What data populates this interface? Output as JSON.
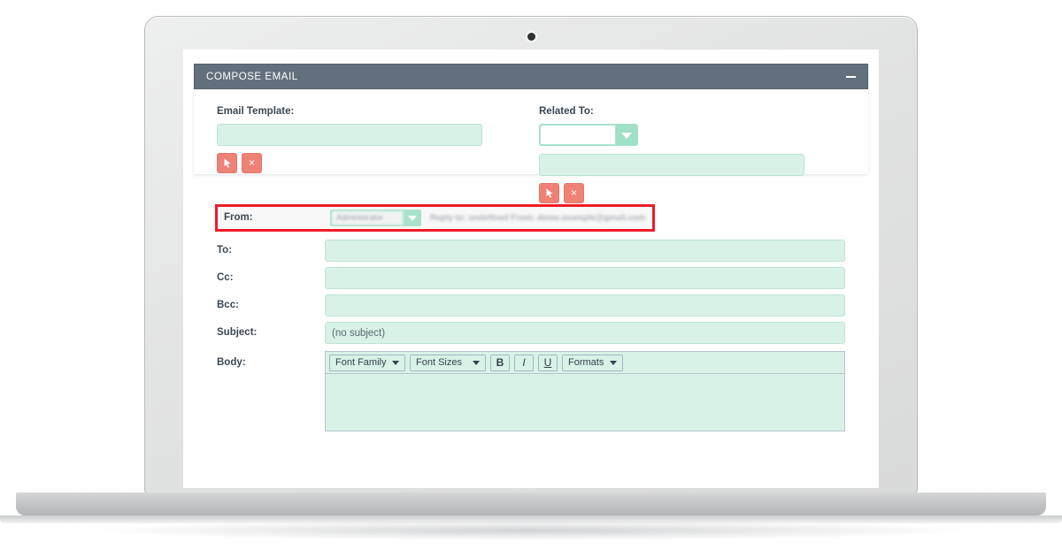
{
  "device": {
    "type": "laptop-mockup",
    "webcam": "webcam-dot"
  },
  "panel": {
    "title": "COMPOSE EMAIL",
    "minimize_label": "–",
    "header_color": "#61707c"
  },
  "colors": {
    "header": "#61707c",
    "input_fill": "#d8f2e7",
    "input_border": "#bce3d2",
    "accent_button": "#ee8276",
    "highlight": "#ee1c25",
    "dropdown_arrow_bg": "#9fe0c6"
  },
  "form": {
    "email_template": {
      "label": "Email Template:",
      "value": "",
      "placeholder": "",
      "buttons": [
        {
          "name": "select",
          "glyph": "⬈"
        },
        {
          "name": "clear",
          "glyph": "×"
        }
      ]
    },
    "related_to": {
      "label": "Related To:",
      "select_value": "",
      "text_value": "",
      "buttons": [
        {
          "name": "select",
          "glyph": "⬈"
        },
        {
          "name": "clear",
          "glyph": "×"
        }
      ]
    },
    "from": {
      "label": "From:",
      "select_value": "Administrator",
      "note": "Reply to: undefined From: demo.example@gmail.com",
      "highlighted": true
    },
    "rows": [
      {
        "label": "To:",
        "value": ""
      },
      {
        "label": "Cc:",
        "value": ""
      },
      {
        "label": "Bcc:",
        "value": ""
      },
      {
        "label": "Subject:",
        "value": "(no subject)"
      }
    ],
    "body": {
      "label": "Body:",
      "content": "",
      "toolbar": [
        {
          "name": "font-family",
          "label": "Font Family",
          "kind": "dropdown"
        },
        {
          "name": "font-sizes",
          "label": "Font Sizes",
          "kind": "dropdown"
        },
        {
          "name": "bold",
          "label": "B",
          "kind": "icon"
        },
        {
          "name": "italic",
          "label": "I",
          "kind": "icon"
        },
        {
          "name": "underline",
          "label": "U",
          "kind": "icon"
        },
        {
          "name": "formats",
          "label": "Formats",
          "kind": "dropdown-inline"
        }
      ]
    }
  }
}
